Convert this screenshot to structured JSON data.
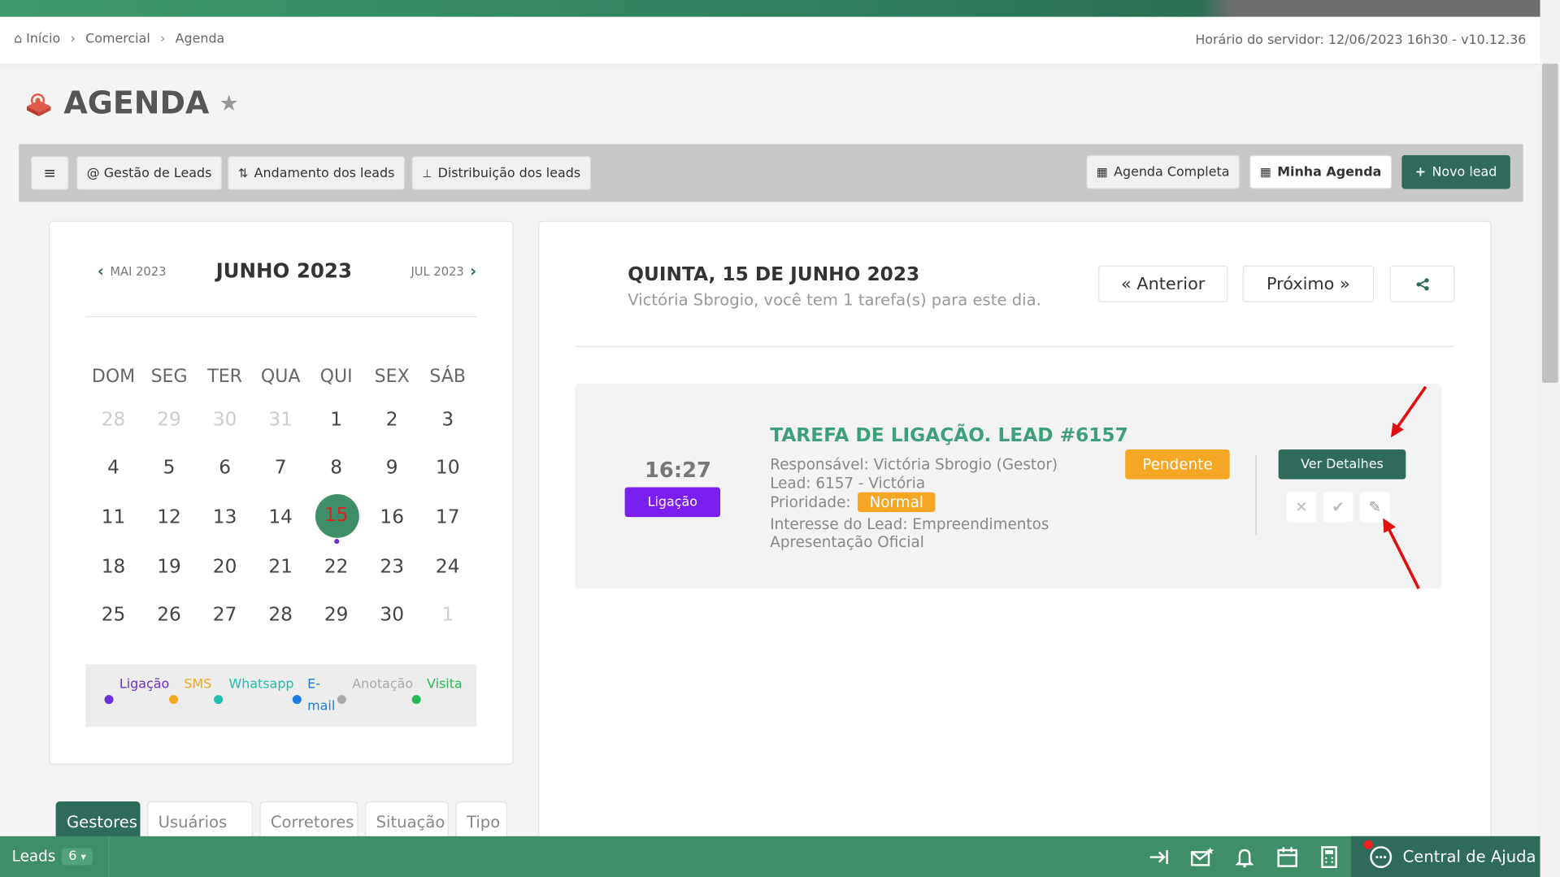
{
  "breadcrumb": {
    "home": "Início",
    "item1": "Comercial",
    "item2": "Agenda"
  },
  "server_time": "Horário do servidor: 12/06/2023 16h30 - v10.12.36",
  "page_title": "AGENDA",
  "toolbar": {
    "gestao": "@ Gestão de Leads",
    "andamento": "Andamento dos leads",
    "distribuicao": "Distribuição dos leads",
    "agenda_completa": "Agenda Completa",
    "minha_agenda": "Minha Agenda",
    "novo_lead": "Novo lead"
  },
  "calendar": {
    "prev": "MAI 2023",
    "current": "JUNHO 2023",
    "next": "JUL 2023",
    "weekdays": [
      "DOM",
      "SEG",
      "TER",
      "QUA",
      "QUI",
      "SEX",
      "SÁB"
    ],
    "weeks": [
      [
        "28",
        "29",
        "30",
        "31",
        "1",
        "2",
        "3"
      ],
      [
        "4",
        "5",
        "6",
        "7",
        "8",
        "9",
        "10"
      ],
      [
        "11",
        "12",
        "13",
        "14",
        "15",
        "16",
        "17"
      ],
      [
        "18",
        "19",
        "20",
        "21",
        "22",
        "23",
        "24"
      ],
      [
        "25",
        "26",
        "27",
        "28",
        "29",
        "30",
        "1"
      ]
    ],
    "selected": "15"
  },
  "legend": {
    "ligacao": "Ligação",
    "sms": "SMS",
    "whatsapp": "Whatsapp",
    "email_1": "E-",
    "email_2": "mail",
    "anotacao": "Anotação",
    "visita": "Visita"
  },
  "legend_colors": {
    "ligacao": "#6a2fd6",
    "sms": "#f5a623",
    "whatsapp": "#1dbfb0",
    "email": "#1a7de0",
    "anotacao": "#aaaaaa",
    "visita": "#22bb55"
  },
  "tabs": [
    "Gestores",
    "Usuários",
    "Corretores",
    "Situação",
    "Tipo"
  ],
  "day": {
    "title": "QUINTA, 15 DE JUNHO 2023",
    "subtitle": "Victória Sbrogio, você tem 1 tarefa(s) para este dia.",
    "prev": "« Anterior",
    "next": "Próximo »"
  },
  "task": {
    "time": "16:27",
    "type": "Ligação",
    "title": "TAREFA DE LIGAÇÃO. LEAD #6157",
    "responsavel": "Responsável: Victória Sbrogio (Gestor)",
    "lead": "Lead: 6157 - Victória",
    "prioridade_label": "Prioridade:",
    "prioridade": "Normal",
    "interesse": "Interesse do Lead: Empreendimentos",
    "interesse2": "Apresentação Oficial",
    "status": "Pendente",
    "details_button": "Ver Detalhes"
  },
  "footer": {
    "leads_label": "Leads",
    "leads_count": "6",
    "help": "Central de Ajuda"
  }
}
